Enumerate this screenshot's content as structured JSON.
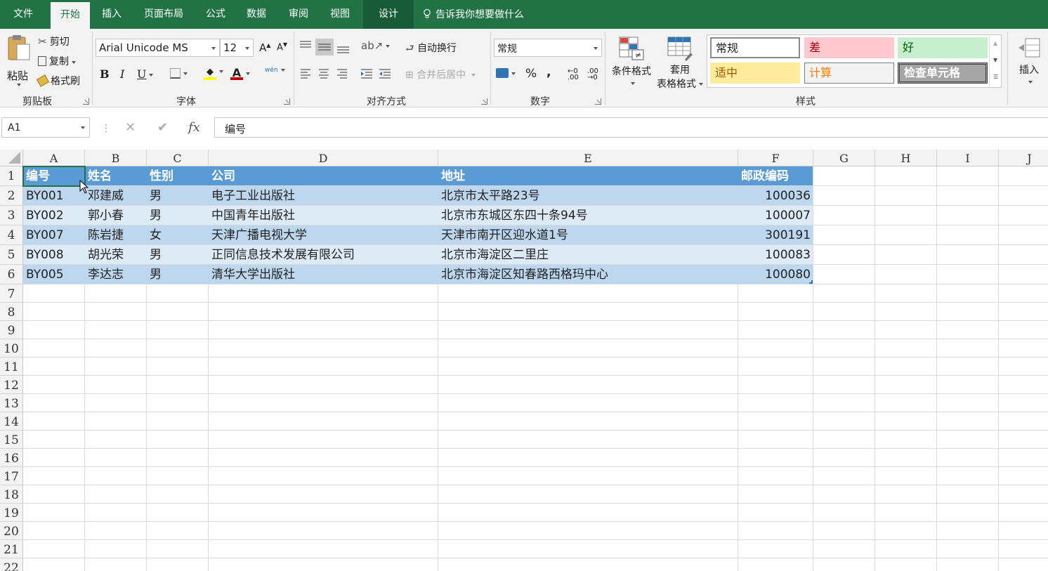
{
  "menu": {
    "tabs": [
      "文件",
      "开始",
      "插入",
      "页面布局",
      "公式",
      "数据",
      "审阅",
      "视图",
      "设计"
    ],
    "active_tab": "开始",
    "tell_me": "告诉我你想要做什么"
  },
  "ribbon": {
    "clipboard": {
      "paste": "粘贴",
      "cut": "剪切",
      "copy": "复制",
      "format_painter": "格式刷",
      "label": "剪贴板"
    },
    "font": {
      "name": "Arial Unicode MS",
      "size": "12",
      "bold": "B",
      "italic": "I",
      "underline": "U",
      "phonetic": "wén",
      "label": "字体"
    },
    "alignment": {
      "wrap_text": "自动换行",
      "merge_center": "合并后居中",
      "label": "对齐方式"
    },
    "number": {
      "format": "常规",
      "percent": "%",
      "comma": ",",
      "label": "数字"
    },
    "styles": {
      "conditional": "条件格式",
      "table_format_1": "套用",
      "table_format_2": "表格格式",
      "cells": [
        {
          "label": "常规",
          "bg": "#ffffff",
          "fg": "#000000"
        },
        {
          "label": "差",
          "bg": "#ffc7ce",
          "fg": "#9c0006"
        },
        {
          "label": "好",
          "bg": "#c6efce",
          "fg": "#006100"
        },
        {
          "label": "适中",
          "bg": "#ffeb9c",
          "fg": "#9c5700"
        },
        {
          "label": "计算",
          "bg": "#f2f2f2",
          "fg": "#fa7d00"
        },
        {
          "label": "检查单元格",
          "bg": "#a5a5a5",
          "fg": "#ffffff"
        }
      ],
      "label": "样式"
    },
    "cells": {
      "insert": "插入"
    }
  },
  "formula_bar": {
    "name_box": "A1",
    "fx": "fx",
    "content": "编号"
  },
  "sheet": {
    "columns": [
      "A",
      "B",
      "C",
      "D",
      "E",
      "F",
      "G",
      "H",
      "I",
      "J"
    ],
    "rows": [
      "1",
      "2",
      "3",
      "4",
      "5",
      "6",
      "7",
      "8",
      "9",
      "10",
      "11",
      "12",
      "13",
      "14",
      "15",
      "16",
      "17",
      "18",
      "19",
      "20",
      "21",
      "22"
    ],
    "header": [
      "编号",
      "姓名",
      "性别",
      "公司",
      "地址",
      "邮政编码"
    ],
    "data": [
      [
        "BY001",
        "邓建威",
        "男",
        "电子工业出版社",
        "北京市太平路23号",
        "100036"
      ],
      [
        "BY002",
        "郭小春",
        "男",
        "中国青年出版社",
        "北京市东城区东四十条94号",
        "100007"
      ],
      [
        "BY007",
        "陈岩捷",
        "女",
        "天津广播电视大学",
        "天津市南开区迎水道1号",
        "300191"
      ],
      [
        "BY008",
        "胡光荣",
        "男",
        "正同信息技术发展有限公司",
        "北京市海淀区二里庄",
        "100083"
      ],
      [
        "BY005",
        "李达志",
        "男",
        "清华大学出版社",
        "北京市海淀区知春路西格玛中心",
        "100080"
      ]
    ],
    "colors": {
      "header_band": "#5b9bd5",
      "band_dark": "#bdd7ee",
      "band_light": "#ddebf7"
    }
  }
}
